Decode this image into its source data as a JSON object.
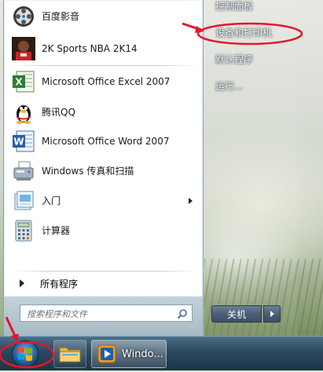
{
  "programs": [
    {
      "label": "百度影音",
      "icon": "baidu-player-icon"
    },
    {
      "label": "2K Sports NBA 2K14",
      "icon": "nba-2k14-icon"
    },
    {
      "label": "Microsoft Office Excel 2007",
      "icon": "excel-icon"
    },
    {
      "label": "腾讯QQ",
      "icon": "qq-penguin-icon"
    },
    {
      "label": "Microsoft Office Word 2007",
      "icon": "word-icon"
    },
    {
      "label": "Windows 传真和扫描",
      "icon": "fax-scan-icon"
    },
    {
      "label": "入门",
      "icon": "getting-started-icon"
    },
    {
      "label": "计算器",
      "icon": "calculator-icon"
    }
  ],
  "all_programs_label": "所有程序",
  "search": {
    "placeholder": "搜索程序和文件"
  },
  "right_items": [
    {
      "label": "控制面板"
    },
    {
      "label": "设备和打印机"
    },
    {
      "label": "默认程序"
    },
    {
      "label": "运行..."
    }
  ],
  "shutdown_label": "关机",
  "taskbar": {
    "window_label": "Windo..."
  },
  "colors": {
    "annotation_red": "#e3162b",
    "taskbar": "#2d4a60",
    "menu_white": "#ffffff"
  }
}
